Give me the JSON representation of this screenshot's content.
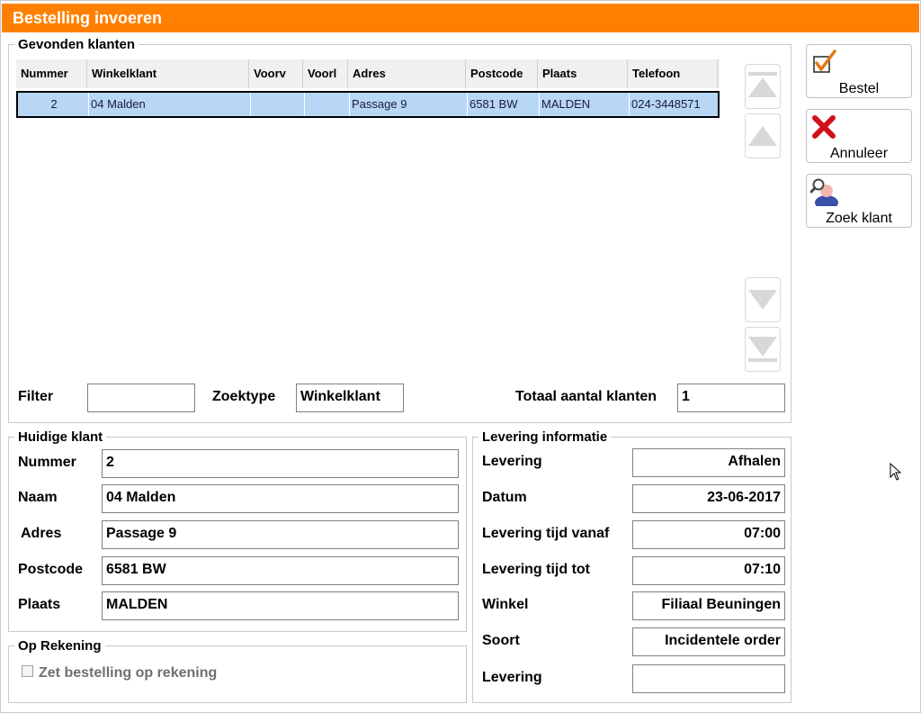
{
  "window": {
    "title": "Bestelling invoeren"
  },
  "found_customers": {
    "legend": "Gevonden klanten",
    "columns": [
      "Nummer",
      "Winkelklant",
      "Voorv",
      "Voorl",
      "Adres",
      "Postcode",
      "Plaats",
      "Telefoon"
    ],
    "rows": [
      {
        "nummer": "2",
        "winkelklant": "04 Malden",
        "voorv": "",
        "voorl": "",
        "adres": "Passage 9",
        "postcode": "6581 BW",
        "plaats": "MALDEN",
        "telefoon": "024-3448571"
      }
    ],
    "filter_label": "Filter",
    "filter_value": "",
    "zoektype_label": "Zoektype",
    "zoektype_value": "Winkelklant",
    "total_label": "Totaal aantal klanten",
    "total_value": "1"
  },
  "current_customer": {
    "legend": "Huidige klant",
    "fields": [
      {
        "label": "Nummer",
        "value": "2"
      },
      {
        "label": "Naam",
        "value": "04 Malden"
      },
      {
        "label": "Adres",
        "value": "Passage 9"
      },
      {
        "label": "Postcode",
        "value": "6581 BW"
      },
      {
        "label": "Plaats",
        "value": "MALDEN"
      }
    ]
  },
  "delivery": {
    "legend": "Levering informatie",
    "fields": [
      {
        "label": "Levering",
        "value": "Afhalen"
      },
      {
        "label": "Datum",
        "value": "23-06-2017"
      },
      {
        "label": "Levering tijd vanaf",
        "value": "07:00"
      },
      {
        "label": "Levering tijd tot",
        "value": "07:10"
      },
      {
        "label": "Winkel",
        "value": "Filiaal Beuningen"
      },
      {
        "label": "Soort",
        "value": "Incidentele order"
      },
      {
        "label": "Levering",
        "value": ""
      }
    ]
  },
  "account": {
    "legend": "Op Rekening",
    "checkbox_label": "Zet bestelling op rekening",
    "checked": false
  },
  "actions": {
    "bestel": "Bestel",
    "annuleer": "Annuleer",
    "zoek_klant": "Zoek klant"
  },
  "colors": {
    "title_bar": "#ff8000",
    "selected_row": "#b7d7f5"
  },
  "icons": [
    "checkmark-icon",
    "red-x-icon",
    "user-search-icon",
    "scroll-top-icon",
    "scroll-up-icon",
    "scroll-down-icon",
    "scroll-bottom-icon"
  ]
}
